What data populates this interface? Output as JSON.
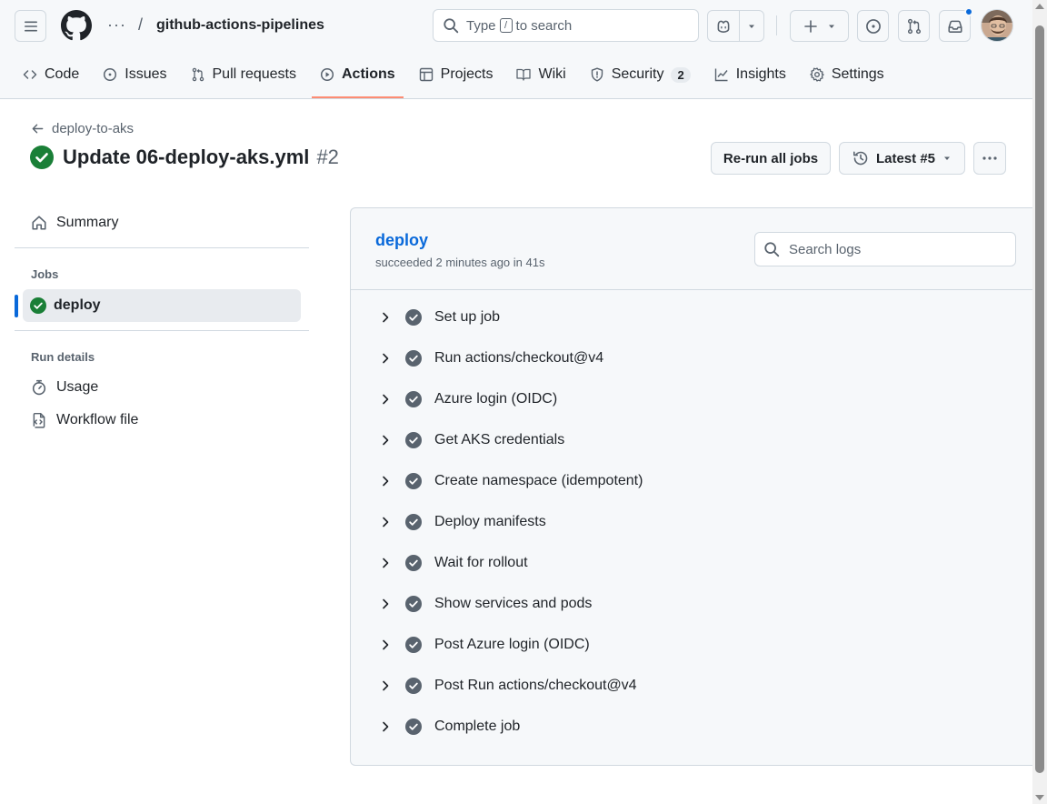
{
  "header": {
    "repo_name": "github-actions-pipelines",
    "breadcrumb_dots": "···",
    "breadcrumb_slash": "/",
    "search": {
      "prefix": "Type",
      "key": "/",
      "suffix": "to search"
    }
  },
  "tabs": [
    {
      "label": "Code",
      "icon": "code-icon"
    },
    {
      "label": "Issues",
      "icon": "issue-icon"
    },
    {
      "label": "Pull requests",
      "icon": "pull-request-icon"
    },
    {
      "label": "Actions",
      "icon": "play-icon",
      "active": true
    },
    {
      "label": "Projects",
      "icon": "table-icon"
    },
    {
      "label": "Wiki",
      "icon": "book-icon"
    },
    {
      "label": "Security",
      "icon": "shield-icon",
      "counter": "2"
    },
    {
      "label": "Insights",
      "icon": "graph-icon"
    },
    {
      "label": "Settings",
      "icon": "gear-icon"
    }
  ],
  "run": {
    "back_label": "deploy-to-aks",
    "title": "Update 06-deploy-aks.yml",
    "run_number": "#2",
    "rerun_label": "Re-run all jobs",
    "latest_label": "Latest #5"
  },
  "sidebar": {
    "summary": "Summary",
    "jobs_heading": "Jobs",
    "job": "deploy",
    "run_details_heading": "Run details",
    "usage": "Usage",
    "workflow_file": "Workflow file"
  },
  "job": {
    "name": "deploy",
    "meta": "succeeded 2 minutes ago in 41s",
    "search_placeholder": "Search logs",
    "steps": [
      "Set up job",
      "Run actions/checkout@v4",
      "Azure login (OIDC)",
      "Get AKS credentials",
      "Create namespace (idempotent)",
      "Deploy manifests",
      "Wait for rollout",
      "Show services and pods",
      "Post Azure login (OIDC)",
      "Post Run actions/checkout@v4",
      "Complete job"
    ]
  },
  "colors": {
    "success": "#1a7f37",
    "step_check": "#59636e",
    "link": "#0969da",
    "active_tab_underline": "#fd8c73"
  }
}
